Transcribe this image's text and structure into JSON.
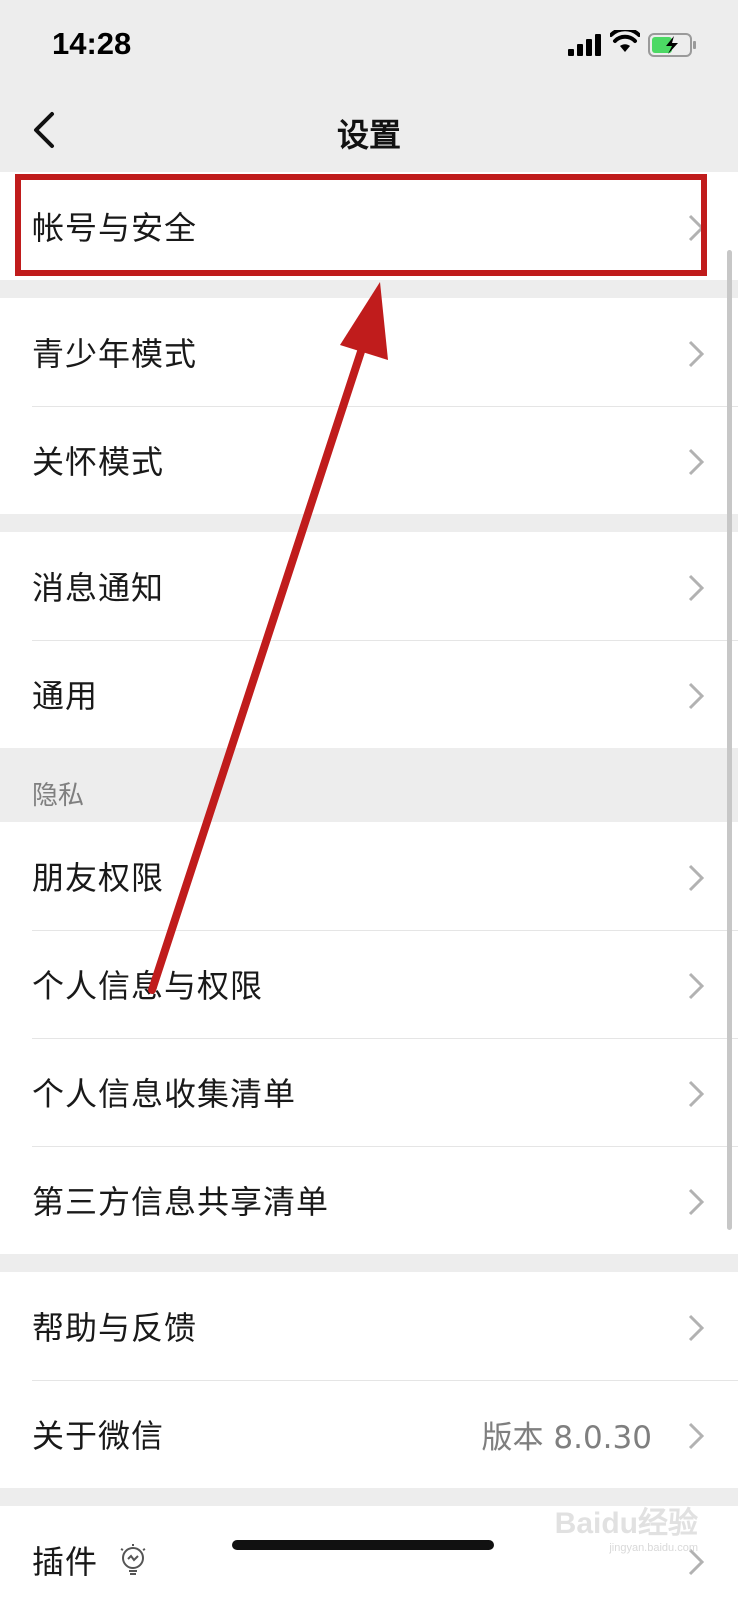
{
  "status": {
    "time": "14:28"
  },
  "nav": {
    "title": "设置"
  },
  "groups": [
    {
      "items": [
        {
          "label": "帐号与安全"
        }
      ]
    },
    {
      "items": [
        {
          "label": "青少年模式"
        },
        {
          "label": "关怀模式"
        }
      ]
    },
    {
      "items": [
        {
          "label": "消息通知"
        },
        {
          "label": "通用"
        }
      ]
    },
    {
      "section": "隐私",
      "items": [
        {
          "label": "朋友权限"
        },
        {
          "label": "个人信息与权限"
        },
        {
          "label": "个人信息收集清单"
        },
        {
          "label": "第三方信息共享清单"
        }
      ]
    },
    {
      "items": [
        {
          "label": "帮助与反馈"
        },
        {
          "label": "关于微信",
          "value": "版本 8.0.30"
        }
      ]
    },
    {
      "items": [
        {
          "label": "插件"
        }
      ]
    }
  ],
  "watermark": {
    "brand": "Baidu经验",
    "url": "jingyan.baidu.com"
  },
  "colors": {
    "annotation": "#c01c1c",
    "background": "#ededed"
  }
}
